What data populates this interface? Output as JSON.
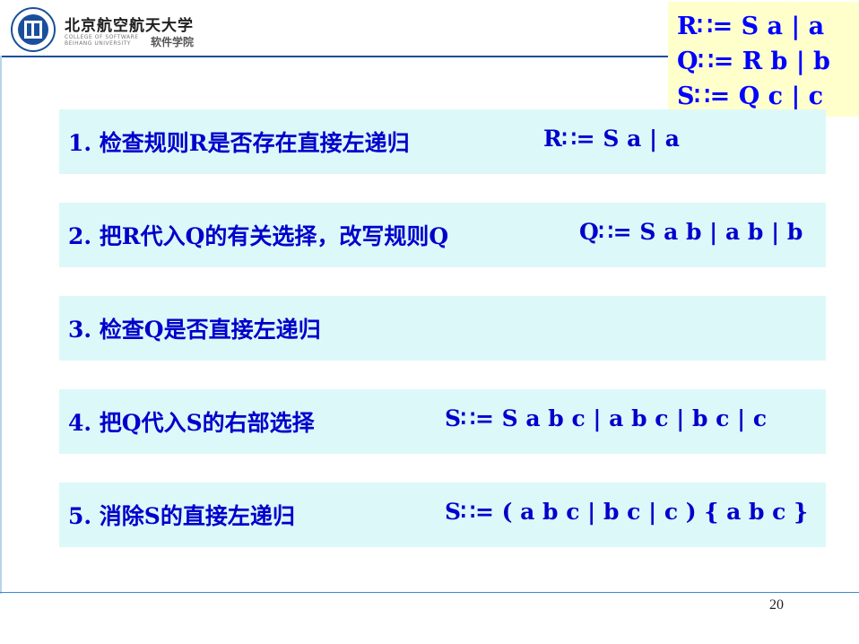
{
  "header": {
    "university_name": "北京航空航天大学",
    "college_en": "COLLEGE OF SOFTWARE BEIHANG UNIVERSITY",
    "college_cn": "软件学院"
  },
  "rules": [
    "R∷= S a | a",
    "Q∷= R b | b",
    "S∷= Q c | c"
  ],
  "steps": [
    {
      "label": "1. 检查规则R是否存在直接左递归",
      "formula": "R∷= S a | a"
    },
    {
      "label": "2. 把R代入Q的有关选择，改写规则Q",
      "formula": "Q∷= S a b | a b | b"
    },
    {
      "label": "3. 检查Q是否直接左递归",
      "formula": ""
    },
    {
      "label": "4. 把Q代入S的右部选择",
      "formula": "S∷= S a b c | a b c | b c | c"
    },
    {
      "label": "5. 消除S的直接左递归",
      "formula": "S∷= ( a b c | b c | c ) { a b c }"
    }
  ],
  "page_number": "20",
  "colors": {
    "text_blue": "#0000cc",
    "step_bg": "#ddf8f8",
    "rule_box_bg": "#ffffcc",
    "header_line": "#1a4f9c"
  }
}
